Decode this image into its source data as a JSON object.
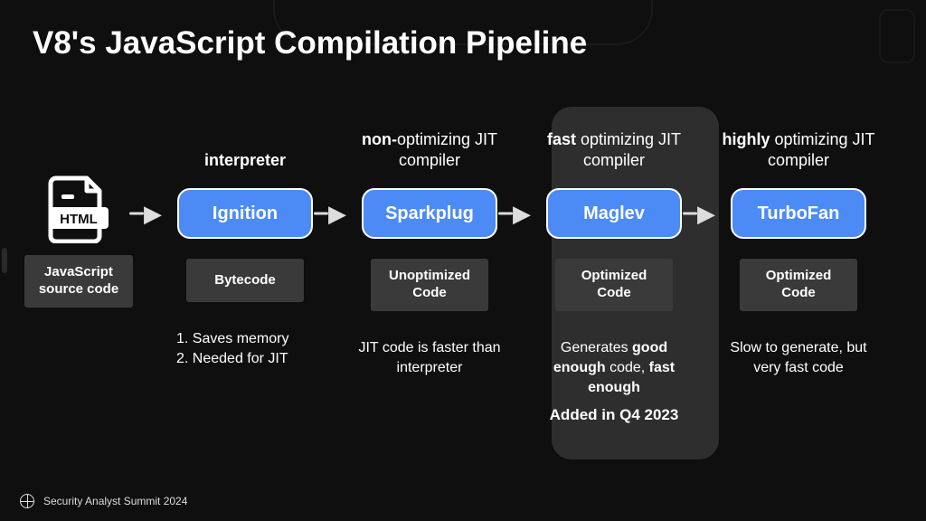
{
  "title": "V8's JavaScript Compilation Pipeline",
  "footer": "Security Analyst Summit 2024",
  "html_source": {
    "icon_label": "HTML",
    "caption": "JavaScript source code"
  },
  "stages": [
    {
      "top_label_bold": "interpreter",
      "top_label_rest": "",
      "name": "Ignition",
      "caption": "Bytecode",
      "note1": "1. Saves memory",
      "note2": "2. Needed for JIT"
    },
    {
      "top_label_bold": "non-",
      "top_label_rest": "optimizing JIT compiler",
      "name": "Sparkplug",
      "caption": "Unoptimized Code",
      "note_plain": "JIT code is faster than interpreter"
    },
    {
      "top_label_bold": "fast",
      "top_label_rest": " optimizing JIT compiler",
      "name": "Maglev",
      "caption": "Optimized Code",
      "note_pre": "Generates ",
      "note_b1": "good enough",
      "note_mid": " code, ",
      "note_b2": "fast enough",
      "added": "Added in Q4 2023"
    },
    {
      "top_label_bold": "highly",
      "top_label_rest": " optimizing JIT compiler",
      "name": "TurboFan",
      "caption": "Optimized Code",
      "note_plain": "Slow to generate, but very fast code"
    }
  ]
}
